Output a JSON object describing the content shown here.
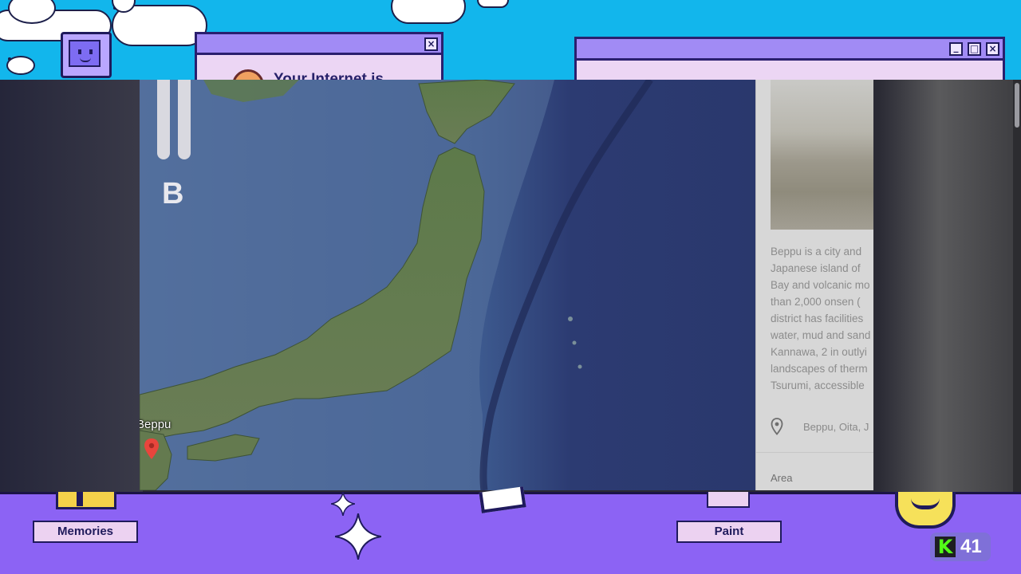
{
  "desktop": {
    "popup_title": "Your Internet is",
    "popup_close_glyph": "×",
    "window_minimize_glyph": "_",
    "window_maximize_glyph": "□",
    "window_close_glyph": "×"
  },
  "map": {
    "marker_label": "Beppu",
    "overlay_letter": "B"
  },
  "panel": {
    "description_lines": [
      "Beppu is a city and",
      "Japanese island of",
      "Bay and volcanic mo",
      "than 2,000 onsen (",
      "district has facilities",
      "water, mud and sand",
      "Kannawa, 2 in outlyi",
      "landscapes of therm",
      "Tsurumi, accessible"
    ],
    "location": "Beppu, Oita, J",
    "area_label": "Area"
  },
  "taskbar": {
    "memories_label": "Memories",
    "paint_label": "Paint",
    "k_letter": "K",
    "viewer_count": "41"
  },
  "icons": [
    "robot-icon",
    "sparkle-icon",
    "location-pin-icon",
    "map-marker-icon",
    "smiley-icon",
    "kick-logo-icon"
  ],
  "colors": {
    "sky": "#12b6ec",
    "taskbar": "#8c63f4",
    "window_bar": "#a18bf5",
    "kick_green": "#53fc18"
  }
}
